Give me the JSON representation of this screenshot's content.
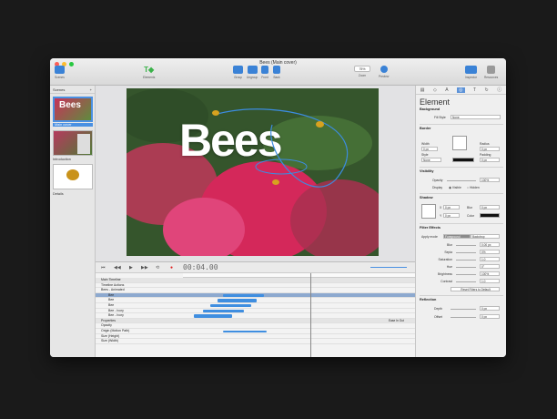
{
  "window": {
    "title": "Bees (Main cover)"
  },
  "toolbar": {
    "scenes_label": "Scenes",
    "elements_label": "Elements",
    "group_label": "Group",
    "ungroup_label": "Ungroup",
    "front_label": "Front",
    "back_label": "Back",
    "zoom_value": "75%",
    "zoom_label": "Zoom",
    "preview_label": "Preview",
    "inspector_label": "Inspector",
    "resources_label": "Resources"
  },
  "scenes": {
    "header": "Scenes",
    "add": "+",
    "items": [
      {
        "label": "Main cover",
        "selected": true
      },
      {
        "label": "Introduction",
        "selected": false
      },
      {
        "label": "Details",
        "selected": false
      }
    ]
  },
  "canvas": {
    "title": "Bees"
  },
  "timeline": {
    "timecode": "00:04.00",
    "rows": [
      {
        "label": "Main Timeline",
        "type": "hdr"
      },
      {
        "label": "Timeline Actions",
        "type": "norm"
      },
      {
        "label": "Bees - Animated",
        "type": "norm"
      },
      {
        "label": "Bee",
        "type": "sel"
      },
      {
        "label": "Bee",
        "type": "norm"
      },
      {
        "label": "Bee",
        "type": "norm"
      },
      {
        "label": "Bee - Ivory",
        "type": "norm"
      },
      {
        "label": "Bee - Ivory",
        "type": "norm"
      },
      {
        "label": "Properties",
        "type": "hdr"
      },
      {
        "label": "Opacity",
        "type": "norm"
      },
      {
        "label": "Origin (Motion Path)",
        "type": "norm"
      },
      {
        "label": "Size (Height)",
        "type": "norm"
      },
      {
        "label": "Size (Width)",
        "type": "norm"
      }
    ],
    "easing": "Ease In Out"
  },
  "inspector": {
    "title": "Element",
    "background": {
      "section": "Background",
      "fill_label": "Fill Style",
      "fill_value": "None"
    },
    "border": {
      "section": "Border",
      "width_label": "Width",
      "width_value": "0 px",
      "radius_label": "Radius",
      "radius_value": "0 px",
      "style_label": "Style",
      "style_value": "None",
      "color_label": "Color",
      "padding_label": "Padding",
      "padding_value": "0 px"
    },
    "visibility": {
      "section": "Visibility",
      "opacity_label": "Opacity",
      "opacity_value": "100%",
      "display_label": "Display",
      "visible_label": "Visible",
      "hidden_label": "Hidden"
    },
    "shadow": {
      "section": "Shadow",
      "x_label": "X",
      "x_value": "0 px",
      "blur_label": "Blur",
      "blur_value": "0 px",
      "y_label": "Y",
      "y_value": "0 px",
      "color_label": "Color"
    },
    "filters": {
      "section": "Filter Effects",
      "apply_label": "Apply mode",
      "mode_fg": "Foreground",
      "mode_bd": "Backdrop",
      "items": [
        {
          "label": "Blur",
          "value": "0.00 px"
        },
        {
          "label": "Sepia",
          "value": "0%"
        },
        {
          "label": "Saturation",
          "value": "1.0"
        },
        {
          "label": "Hue",
          "value": "0°"
        },
        {
          "label": "Brightness",
          "value": "100%"
        },
        {
          "label": "Contrast",
          "value": "1.0"
        }
      ],
      "reset_label": "Reset Filters to Default"
    },
    "reflection": {
      "section": "Reflection",
      "depth_label": "Depth",
      "depth_value": "0 px",
      "offset_label": "Offset",
      "offset_value": "0 px"
    }
  },
  "colors": {
    "accent": "#4a90e2",
    "bar": "#3f8ee0",
    "desktop": "#1a1a1a"
  }
}
